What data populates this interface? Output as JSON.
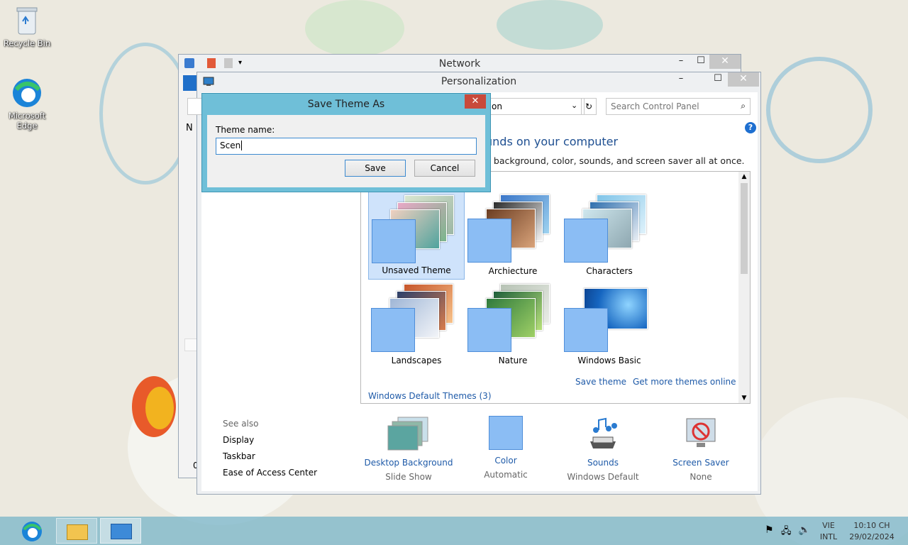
{
  "desktop": {
    "icons": [
      {
        "label": "Recycle Bin"
      },
      {
        "label": "Microsoft Edge"
      }
    ]
  },
  "network_window": {
    "title": "Network",
    "partial_left_text": "N",
    "partial_bottom_text": "0"
  },
  "personalization_window": {
    "title": "Personalization",
    "address_fragment": "on",
    "search_placeholder": "Search Control Panel",
    "heading_fragment": "unds on your computer",
    "subheading_fragment": "p background, color, sounds, and screen saver all at once.",
    "themes": [
      {
        "label": "Unsaved Theme",
        "selected": true
      },
      {
        "label": "Archiecture",
        "selected": false
      },
      {
        "label": "Characters",
        "selected": false
      },
      {
        "label": "Landscapes",
        "selected": false
      },
      {
        "label": "Nature",
        "selected": false
      },
      {
        "label": "Windows Basic",
        "selected": false
      }
    ],
    "save_theme_link": "Save theme",
    "get_more_link": "Get more themes online",
    "group_label": "Windows Default Themes (3)",
    "see_also": {
      "heading": "See also",
      "items": [
        "Display",
        "Taskbar",
        "Ease of Access Center"
      ]
    },
    "bottom": [
      {
        "title": "Desktop Background",
        "value": "Slide Show",
        "icon": "photos-icon"
      },
      {
        "title": "Color",
        "value": "Automatic",
        "icon": "color-palette-icon"
      },
      {
        "title": "Sounds",
        "value": "Windows Default",
        "icon": "sounds-icon"
      },
      {
        "title": "Screen Saver",
        "value": "None",
        "icon": "screen-saver-icon"
      }
    ]
  },
  "dialog": {
    "title": "Save Theme As",
    "field_label": "Theme name:",
    "field_value": "Scen",
    "save_label": "Save",
    "cancel_label": "Cancel"
  },
  "taskbar": {
    "lang_top": "VIE",
    "lang_bottom": "INTL",
    "time": "10:10 CH",
    "date": "29/02/2024"
  },
  "colors": {
    "accent": "#1e5aa8",
    "dialog_border": "#5aaec9",
    "close_red": "#c94a3b",
    "selected_tile": "#cfe3fb"
  }
}
